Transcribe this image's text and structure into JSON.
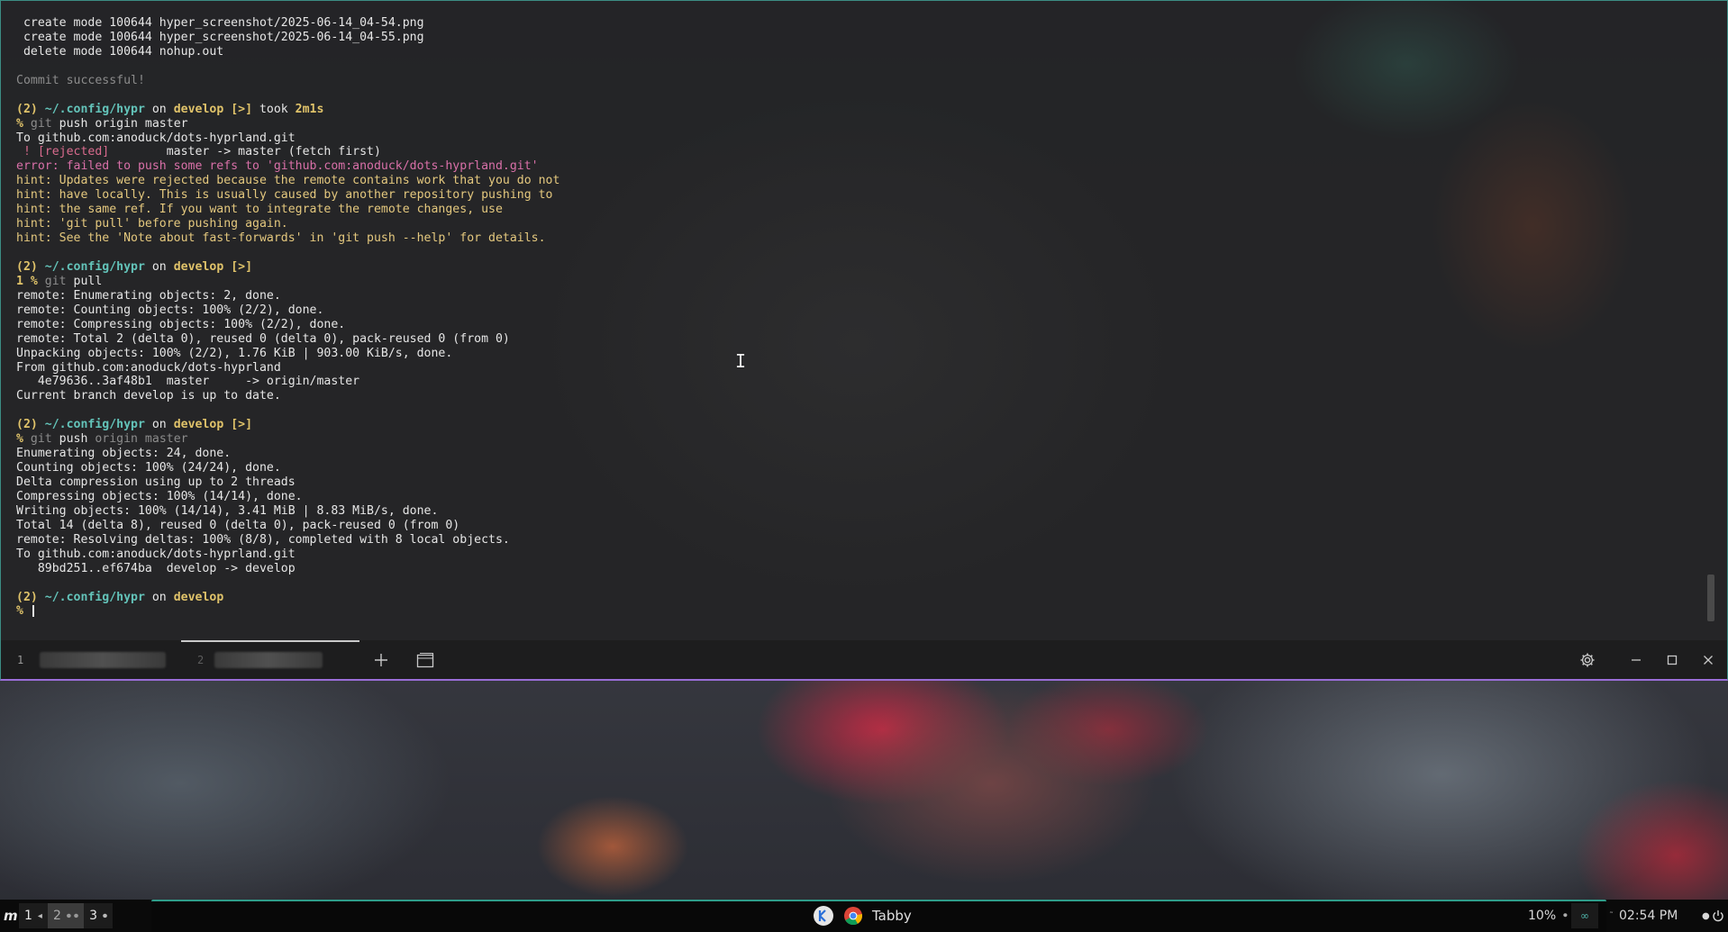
{
  "terminal": {
    "lines": [
      [
        {
          "t": " create mode 100644 hyper_screenshot/2025-06-14_04-54.png"
        }
      ],
      [
        {
          "t": " create mode 100644 hyper_screenshot/2025-06-14_04-55.png"
        }
      ],
      [
        {
          "t": " delete mode 100644 nohup.out"
        }
      ],
      [
        {
          "t": ""
        }
      ],
      [
        {
          "t": "Commit successful!",
          "c": "gray"
        }
      ],
      [
        {
          "t": ""
        }
      ],
      [
        {
          "t": "(2) ",
          "c": "yellow"
        },
        {
          "t": "~/.config/hypr",
          "c": "cyan"
        },
        {
          "t": " on "
        },
        {
          "t": "develop [>]",
          "c": "yellow"
        },
        {
          "t": " took "
        },
        {
          "t": "2m1s",
          "c": "yellow"
        }
      ],
      [
        {
          "t": "% ",
          "c": "yellow"
        },
        {
          "t": "git",
          "c": "gray"
        },
        {
          "t": " push origin master"
        }
      ],
      [
        {
          "t": "To github.com:anoduck/dots-hyprland.git"
        }
      ],
      [
        {
          "t": " ! [rejected]",
          "c": "red"
        },
        {
          "t": "        master -> master (fetch first)"
        }
      ],
      [
        {
          "t": "error: failed to push some refs to 'github.com:anoduck/dots-hyprland.git'",
          "c": "err"
        }
      ],
      [
        {
          "t": "hint: Updates were rejected because the remote contains work that you do not",
          "c": "hint"
        }
      ],
      [
        {
          "t": "hint: have locally. This is usually caused by another repository pushing to",
          "c": "hint"
        }
      ],
      [
        {
          "t": "hint: the same ref. If you want to integrate the remote changes, use",
          "c": "hint"
        }
      ],
      [
        {
          "t": "hint: 'git pull' before pushing again.",
          "c": "hint"
        }
      ],
      [
        {
          "t": "hint: See the 'Note about fast-forwards' in 'git push --help' for details.",
          "c": "hint"
        }
      ],
      [
        {
          "t": ""
        }
      ],
      [
        {
          "t": "(2) ",
          "c": "yellow"
        },
        {
          "t": "~/.config/hypr",
          "c": "cyan"
        },
        {
          "t": " on "
        },
        {
          "t": "develop [>]",
          "c": "yellow"
        }
      ],
      [
        {
          "t": "1 % ",
          "c": "yellow"
        },
        {
          "t": "git",
          "c": "gray"
        },
        {
          "t": " pull"
        }
      ],
      [
        {
          "t": "remote: Enumerating objects: 2, done."
        }
      ],
      [
        {
          "t": "remote: Counting objects: 100% (2/2), done."
        }
      ],
      [
        {
          "t": "remote: Compressing objects: 100% (2/2), done."
        }
      ],
      [
        {
          "t": "remote: Total 2 (delta 0), reused 0 (delta 0), pack-reused 0 (from 0)"
        }
      ],
      [
        {
          "t": "Unpacking objects: 100% (2/2), 1.76 KiB | 903.00 KiB/s, done."
        }
      ],
      [
        {
          "t": "From github.com:anoduck/dots-hyprland"
        }
      ],
      [
        {
          "t": "   4e79636..3af48b1  master     -> origin/master"
        }
      ],
      [
        {
          "t": "Current branch develop is up to date."
        }
      ],
      [
        {
          "t": ""
        }
      ],
      [
        {
          "t": "(2) ",
          "c": "yellow"
        },
        {
          "t": "~/.config/hypr",
          "c": "cyan"
        },
        {
          "t": " on "
        },
        {
          "t": "develop [>]",
          "c": "yellow"
        }
      ],
      [
        {
          "t": "% ",
          "c": "yellow"
        },
        {
          "t": "git",
          "c": "gray"
        },
        {
          "t": " push "
        },
        {
          "t": "origin master",
          "c": "gray"
        }
      ],
      [
        {
          "t": "Enumerating objects: 24, done."
        }
      ],
      [
        {
          "t": "Counting objects: 100% (24/24), done."
        }
      ],
      [
        {
          "t": "Delta compression using up to 2 threads"
        }
      ],
      [
        {
          "t": "Compressing objects: 100% (14/14), done."
        }
      ],
      [
        {
          "t": "Writing objects: 100% (14/14), 3.41 MiB | 8.83 MiB/s, done."
        }
      ],
      [
        {
          "t": "Total 14 (delta 8), reused 0 (delta 0), pack-reused 0 (from 0)"
        }
      ],
      [
        {
          "t": "remote: Resolving deltas: 100% (8/8), completed with 8 local objects."
        }
      ],
      [
        {
          "t": "To github.com:anoduck/dots-hyprland.git"
        }
      ],
      [
        {
          "t": "   89bd251..ef674ba  develop -> develop"
        }
      ],
      [
        {
          "t": ""
        }
      ],
      [
        {
          "t": "(2) ",
          "c": "yellow"
        },
        {
          "t": "~/.config/hypr",
          "c": "cyan"
        },
        {
          "t": " on "
        },
        {
          "t": "develop",
          "c": "yellow"
        }
      ],
      [
        {
          "t": "% ",
          "c": "yellow"
        }
      ]
    ]
  },
  "tabs": [
    {
      "index": "1"
    },
    {
      "index": "2"
    }
  ],
  "tab_buttons": {
    "new_tab_icon": "plus-icon",
    "profiles_icon": "window-icon"
  },
  "window_controls": {
    "settings_icon": "gear-icon",
    "minimize_icon": "minimize-icon",
    "maximize_icon": "maximize-icon",
    "close_icon": "close-icon"
  },
  "taskbar": {
    "launcher_glyph": "m",
    "workspaces": [
      {
        "num": "1",
        "dots": "◂"
      },
      {
        "num": "2",
        "dots": "⏺ ⏺"
      },
      {
        "num": "3",
        "dots": "⏺"
      }
    ],
    "app_title": "Tabby",
    "volume": "10%",
    "clock": "02:54 PM",
    "colors": {
      "accent_border": "#3c8d84",
      "active_border": "#9a6dd8"
    }
  }
}
